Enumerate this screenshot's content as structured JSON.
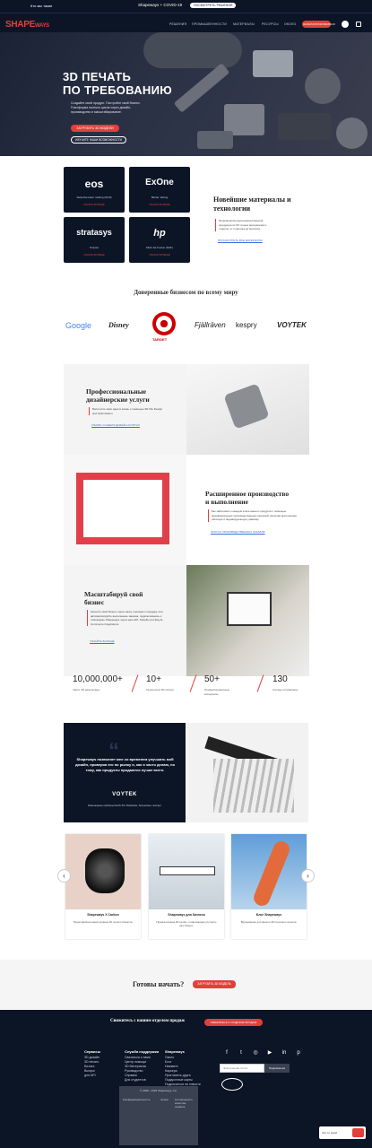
{
  "topbar": {
    "who": "Кто мы такие",
    "covid": "Shapeways + COVID-19",
    "cta": "ПОСМОТРЕТЬ РЕШЕНИЯ"
  },
  "nav": {
    "logo_main": "SHAPE",
    "logo_small": "WAYS",
    "items": [
      "РЕШЕНИЯ",
      "ПРОМЫШЛЕННОСТИ",
      "МАТЕРИАЛЫ",
      "РЕСУРСЫ",
      "ОКОЛО"
    ],
    "signup": "ЗАРЕГИСТРИРОВАТЬСЯ"
  },
  "hero": {
    "title_line1": "3D ПЕЧАТЬ",
    "title_line2": "ПО ТРЕБОВАНИЮ",
    "text": "Создайте свой продукт. Постройте свой бизнес. Платформа полного цикла через дизайн, производство и масштабирование.",
    "btn_primary": "ЗАГРУЗИТЬ 3D МОДЕЛИ",
    "btn_secondary": "ИЗУЧИТЕ НАШИ ВОЗМОЖНОСТИ"
  },
  "materials": {
    "cards": [
      {
        "brand": "eos",
        "sub": "Selective laser melting (SLM)",
        "more": "УЗНАТЬ БОЛЬШЕ"
      },
      {
        "brand": "ExOne",
        "sub": "Binder Jetting",
        "more": "УЗНАТЬ БОЛЬШЕ"
      },
      {
        "brand": "stratasys",
        "sub": "PolyJet",
        "more": "УЗНАТЬ БОЛЬШЕ"
      },
      {
        "brand": "hp",
        "sub": "Multi Jet Fusion (MJF)",
        "more": "УЗНАТЬ БОЛЬШЕ"
      }
    ],
    "title_line1": "Новейшие материалы и",
    "title_line2": "технологии",
    "text": "Производство высококачественной продукции из 60 точных материалов и отделок, от пластика до металла.",
    "link": "ПРОСМОТРЕТЬ ВСЕ МАТЕРИАЛЫ"
  },
  "trusted": {
    "title": "Доверенные бизнесом по всему миру",
    "logos": [
      "Google",
      "Disney",
      "TARGET",
      "Fjällräven",
      "kespry",
      "VOYTEK"
    ]
  },
  "features": [
    {
      "title_line1": "Профессиональные",
      "title_line2": "дизайнерские услуги",
      "text": "Воплотите свои идеи в жизнь с помощью 3D File Design and Optimization.",
      "link": "УЗНАТЬ О НАШИХ ДИЗАЙН-УСЛУГАХ"
    },
    {
      "title_line1": "Расширенное производство",
      "title_line2": "и выполнение",
      "text": "Мы заботимся о каждом этапе вашего продукта с помощью индивидуальных производственных решений, включая выполнение, обычную и индивидуальную упаковку.",
      "link": "ЗАПУСК ПРОИЗВОДСТВЕННЫХ ЗАКАЗОВ"
    },
    {
      "title_line1": "Масштабируй свой",
      "title_line2": "бизнес",
      "text": "Начните свой бизнес через нашу торговую площадку, или автоматизируйте выполнение заказов, подключившись к платформе Shapeways через наш API, Shopify или Etsy E-Commerce Integrations.",
      "link": "УЗНАЙТЕ БОЛЬШЕ"
    }
  ],
  "stats": [
    {
      "num": "10,000,000+",
      "label": "Части 3D напечатаны"
    },
    {
      "num": "10+",
      "label": "Технологии 3D печати"
    },
    {
      "num": "50+",
      "label": "Профессиональные материалы"
    },
    {
      "num": "130",
      "label": "Страны отправлены"
    }
  ],
  "testimonial": {
    "quote": "Shapeways позволяет мне со временем улучшать мой дизайн, проверяя его по рынку и, как я часто делаю, по тому, как продукты продаются лучше всего.",
    "brand": "VOYTEK",
    "caption": "Инженерные приборы Dutch-Pro Rottweiler, бизнесмен, эксперт"
  },
  "carousel": {
    "prev": "‹",
    "next": "›",
    "cards": [
      {
        "title": "Shapeways X Carbon",
        "desc": "Представляем новый уровень 3D печати объектов."
      },
      {
        "title": "Shapeways для бизнеса",
        "desc": "Промышленная 3D печать, позволяющая улучшить наш бизнес."
      },
      {
        "title": "Блог Shapeways",
        "desc": "Вдохновение для вашего 3D печатного проекта."
      }
    ]
  },
  "ready": {
    "title": "Готовы начать?",
    "btn": "ЗАГРУЗИТЬ 3D МОДЕЛЬ"
  },
  "footer": {
    "contact": "Свяжитесь с нашим отделом продаж",
    "contact_btn": "СВЯЖИТЕСЬ С ОТДЕЛОМ ПРОДАЖ",
    "col1": {
      "head": "Сервисы",
      "items": [
        "3D дизайн",
        "3D печать",
        "Бизнес",
        "Выпуск",
        "для API"
      ]
    },
    "col2": {
      "head": "Служба поддержки",
      "items": [
        "Связаться с нами",
        "Центр помощи",
        "3D Материалы",
        "Руководство",
        "Справка",
        "Для студентов"
      ]
    },
    "col3": {
      "head": "Shapeways",
      "items": [
        "Около",
        "Блог",
        "Нажмите",
        "Карьера",
        "Пригласить друга",
        "Подарочные карты",
        "Подписаться на новости"
      ]
    },
    "social": [
      "f",
      "t",
      "◎",
      "▶",
      "in",
      "p"
    ],
    "subscribe_placeholder": "Электронная почта",
    "subscribe_btn": "Подписаться",
    "copyright": "© 2008 - 2020 Shapeways, Inc.",
    "bottom_links": [
      "Конфиденциальность",
      "Срока",
      "Соглашения о качестве сервиса"
    ],
    "chat_label": "Чат со мной"
  }
}
